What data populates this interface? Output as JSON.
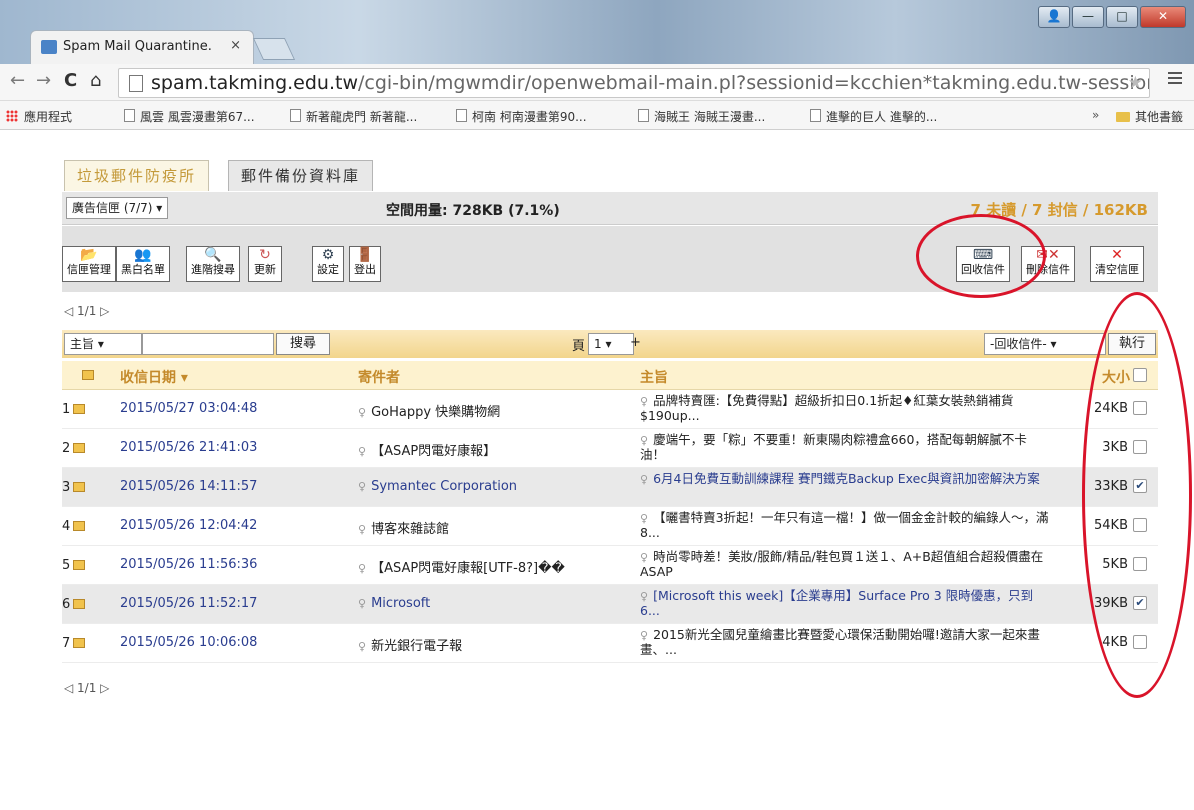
{
  "browser": {
    "tab_title": "Spam Mail Quarantine.",
    "tab_close": "×",
    "url_host": "spam.takming.edu.tw",
    "url_path": "/cgi-bin/mgwmdir/openwebmail-main.pl?sessionid=kcchien*takming.edu.tw-sessioı",
    "win_buttons": [
      "👤",
      "—",
      "□",
      "✕"
    ],
    "nav": {
      "back": "←",
      "forward": "→",
      "reload": "C",
      "home": "⌂"
    },
    "bookmarks": [
      "應用程式",
      "風雲 風雲漫畫第67...",
      "新著龍虎門 新著龍...",
      "柯南 柯南漫畫第90...",
      "海賊王 海賊王漫畫...",
      "進擊的巨人 進擊的..."
    ],
    "bookmarks_more": "»",
    "other_bookmarks": "其他書籤"
  },
  "tabs": {
    "active": "垃圾郵件防疫所",
    "inactive": "郵件備份資料庫"
  },
  "infobar": {
    "folder_select": "廣告信匣 (7/7) ▾",
    "usage": "空間用量: 728KB (7.1%)",
    "counts": "7 未讀 / 7 封信 / 162KB"
  },
  "buttons_left": [
    {
      "icon": "📂",
      "label": "信匣管理"
    },
    {
      "icon": "👥",
      "label": "黑白名單"
    },
    {
      "icon": "🔍",
      "label": "進階搜尋"
    },
    {
      "icon": "↻",
      "label": "更新"
    },
    {
      "icon": "⚙",
      "label": "設定"
    },
    {
      "icon": "🚪",
      "label": "登出"
    }
  ],
  "buttons_right": [
    {
      "icon": "⌨",
      "label": "回收信件"
    },
    {
      "icon": "✉✕",
      "label": "刪除信件"
    },
    {
      "icon": "✕",
      "label": "清空信匣"
    }
  ],
  "pager": "◁ 1/1 ▷",
  "search": {
    "field_select": "主旨    ▾",
    "button": "搜尋",
    "page_label": "頁",
    "page_select": "1 ▾",
    "page_plus": "+",
    "action_select": "-回收信件-      ▾",
    "execute": "執行"
  },
  "columns": {
    "date": "收信日期 ▾",
    "from": "寄件者",
    "subject": "主旨",
    "size": "大小"
  },
  "messages": [
    {
      "idx": "1",
      "date": "2015/05/27 03:04:48",
      "from": "GoHappy 快樂購物網",
      "subject": "品牌特賣匯:【免費得點】超級折扣日0.1折起♦紅葉女裝熱銷補貨$190up...",
      "size": "24KB",
      "checked": "",
      "hl": false
    },
    {
      "idx": "2",
      "date": "2015/05/26 21:41:03",
      "from": "【ASAP閃電好康報】",
      "subject": "慶端午，要「粽」不要重！新東陽肉粽禮盒660，搭配每朝解膩不卡油！",
      "size": "3KB",
      "checked": "",
      "hl": false
    },
    {
      "idx": "3",
      "date": "2015/05/26 14:11:57",
      "from": "Symantec Corporation",
      "subject": "6月4日免費互動訓練課程 賽門鐵克Backup Exec與資訊加密解決方案",
      "size": "33KB",
      "checked": "✔",
      "hl": true
    },
    {
      "idx": "4",
      "date": "2015/05/26 12:04:42",
      "from": "博客來雜誌館",
      "subject": "【曬書特賣3折起！一年只有這一檔！】做一個金金計較的編錄人～，滿8...",
      "size": "54KB",
      "checked": "",
      "hl": false
    },
    {
      "idx": "5",
      "date": "2015/05/26 11:56:36",
      "from": "【ASAP閃電好康報[UTF-8?]��",
      "subject": "時尚零時差！美妝/服飾/精品/鞋包買１送１、A+B超值組合超殺價盡在ASAP",
      "size": "5KB",
      "checked": "",
      "hl": false
    },
    {
      "idx": "6",
      "date": "2015/05/26 11:52:17",
      "from": "Microsoft",
      "subject": "[Microsoft this week]【企業專用】Surface Pro 3 限時優惠，只到 6...",
      "size": "39KB",
      "checked": "✔",
      "hl": true
    },
    {
      "idx": "7",
      "date": "2015/05/26 10:06:08",
      "from": "新光銀行電子報",
      "subject": "2015新光全國兒童繪畫比賽暨愛心環保活動開始囉!邀請大家一起來畫畫、...",
      "size": "4KB",
      "checked": "",
      "hl": false
    }
  ]
}
